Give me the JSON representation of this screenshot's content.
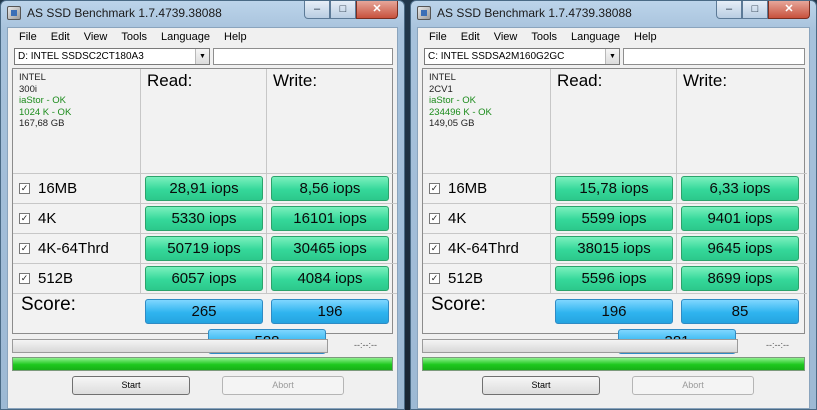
{
  "windows": [
    {
      "title": "AS SSD Benchmark 1.7.4739.38088",
      "menu": [
        "File",
        "Edit",
        "View",
        "Tools",
        "Language",
        "Help"
      ],
      "drive": "D: INTEL SSDSC2CT180A3",
      "info": {
        "vendor": "INTEL",
        "firmware": "300i",
        "driver": "iaStor - OK",
        "alignment": "1024 K - OK",
        "size": "167,68 GB"
      },
      "read_header": "Read:",
      "write_header": "Write:",
      "rows": [
        {
          "label": "16MB",
          "checked": true,
          "read": "28,91 iops",
          "write": "8,56 iops"
        },
        {
          "label": "4K",
          "checked": true,
          "read": "5330 iops",
          "write": "16101 iops"
        },
        {
          "label": "4K-64Thrd",
          "checked": true,
          "read": "50719 iops",
          "write": "30465 iops"
        },
        {
          "label": "512B",
          "checked": true,
          "read": "6057 iops",
          "write": "4084 iops"
        }
      ],
      "score_label": "Score:",
      "score_read": "265",
      "score_write": "196",
      "score_total": "588",
      "time": "--:--:--",
      "progress_fraction": 1.0,
      "start_label": "Start",
      "abort_label": "Abort"
    },
    {
      "title": "AS SSD Benchmark 1.7.4739.38088",
      "menu": [
        "File",
        "Edit",
        "View",
        "Tools",
        "Language",
        "Help"
      ],
      "drive": "C: INTEL SSDSA2M160G2GC",
      "info": {
        "vendor": "INTEL",
        "firmware": "2CV1",
        "driver": "iaStor - OK",
        "alignment": "234496 K - OK",
        "size": "149,05 GB"
      },
      "read_header": "Read:",
      "write_header": "Write:",
      "rows": [
        {
          "label": "16MB",
          "checked": true,
          "read": "15,78 iops",
          "write": "6,33 iops"
        },
        {
          "label": "4K",
          "checked": true,
          "read": "5599 iops",
          "write": "9401 iops"
        },
        {
          "label": "4K-64Thrd",
          "checked": true,
          "read": "38015 iops",
          "write": "9645 iops"
        },
        {
          "label": "512B",
          "checked": true,
          "read": "5596 iops",
          "write": "8699 iops"
        }
      ],
      "score_label": "Score:",
      "score_read": "196",
      "score_write": "85",
      "score_total": "381",
      "time": "--:--:--",
      "progress_fraction": 1.0,
      "start_label": "Start",
      "abort_label": "Abort"
    }
  ],
  "colors": {
    "result_green": "#35d89a",
    "score_blue": "#2fb4ef",
    "progress_green": "#1ec81e",
    "ok_text": "#1c8c1c"
  }
}
